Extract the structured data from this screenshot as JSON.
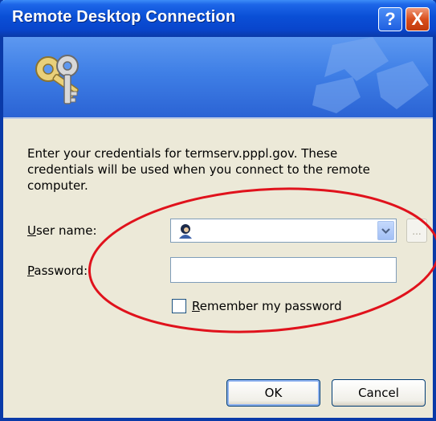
{
  "window": {
    "title": "Remote Desktop Connection",
    "help_symbol": "?",
    "close_symbol": "X"
  },
  "dialog": {
    "description": "Enter your credentials for termserv.pppl.gov. These credentials will be used when you connect to the remote computer.",
    "username_label_first": "U",
    "username_label_rest": "ser name:",
    "username_value": "",
    "browse_label": "...",
    "password_label_first": "P",
    "password_label_rest": "assword:",
    "password_value": "",
    "remember_label_first": "R",
    "remember_label_rest": "emember my password",
    "remember_checked": false,
    "ok_label": "OK",
    "cancel_label": "Cancel"
  },
  "colors": {
    "titlebar": "#0a4fd6",
    "banner": "#3f7fe6",
    "dialog_bg": "#ece9d8",
    "annotation": "#e0121c"
  },
  "icons": [
    "keys-icon",
    "user-icon",
    "chevron-down-icon",
    "help-icon",
    "close-icon"
  ]
}
